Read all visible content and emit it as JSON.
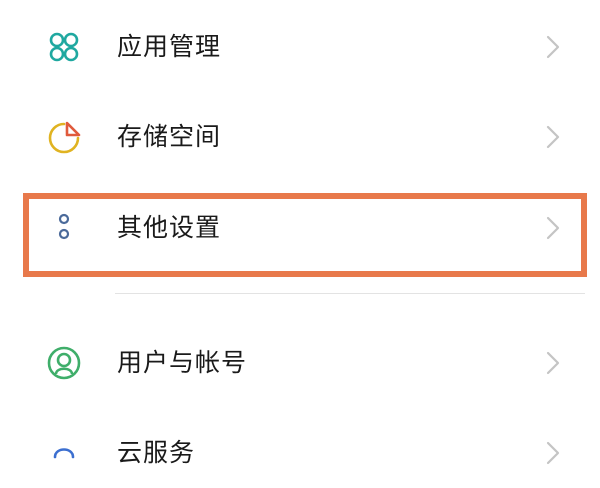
{
  "settings": {
    "items": [
      {
        "label": "应用管理",
        "icon": "app-management-icon",
        "icon_color": "#1fa8a0"
      },
      {
        "label": "存储空间",
        "icon": "storage-pie-icon",
        "icon_color": "#e0b321",
        "accent_color": "#e05a3c"
      },
      {
        "label": "其他设置",
        "icon": "more-dots-icon",
        "icon_color": "#4b6a9a"
      },
      {
        "label": "用户与帐号",
        "icon": "user-account-icon",
        "icon_color": "#3fae6a"
      },
      {
        "label": "云服务",
        "icon": "cloud-service-icon",
        "icon_color": "#3c6fd0"
      }
    ]
  },
  "highlight": {
    "color": "#e8794b"
  },
  "chevron": {
    "icon": "chevron-right-icon",
    "color": "#c4c4c4"
  }
}
